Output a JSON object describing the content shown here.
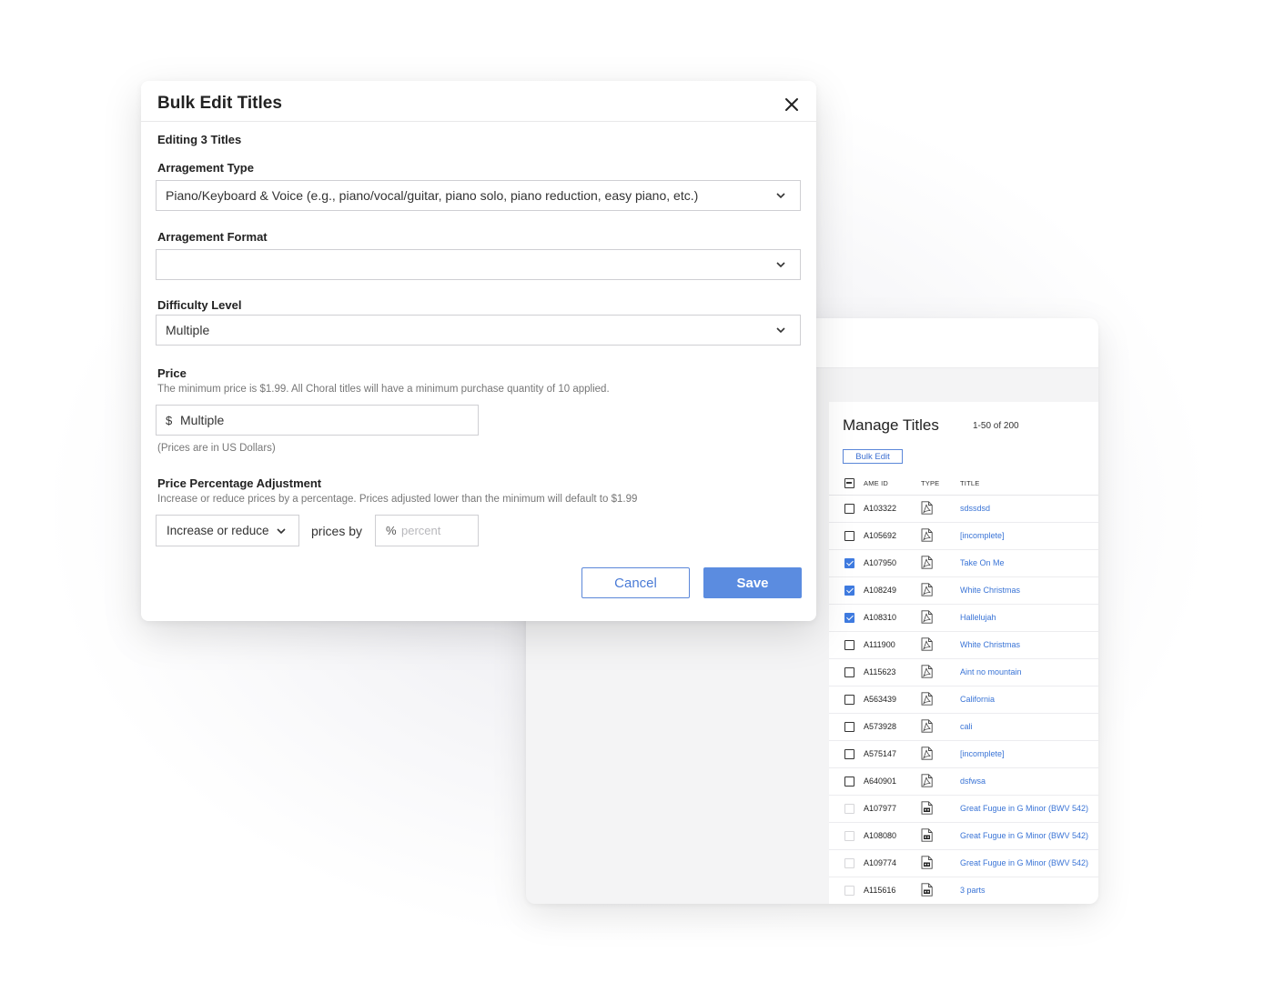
{
  "modal": {
    "title": "Bulk Edit Titles",
    "editing_label": "Editing 3 Titles",
    "arrangement_type": {
      "label": "Arragement Type",
      "value": "Piano/Keyboard & Voice (e.g., piano/vocal/guitar, piano solo, piano reduction, easy piano, etc.)"
    },
    "arrangement_format": {
      "label": "Arragement Format",
      "value": ""
    },
    "difficulty": {
      "label": "Difficulty Level",
      "value": "Multiple"
    },
    "price": {
      "label": "Price",
      "help": "The minimum price is $1.99. All Choral titles will have a minimum purchase quantity of 10 applied.",
      "currency": "$",
      "value": "Multiple",
      "note": "(Prices are in US Dollars)"
    },
    "adjustment": {
      "label": "Price Percentage Adjustment",
      "help": "Increase or reduce prices by a percentage. Prices adjusted lower than the minimum will default to $1.99",
      "direction": "Increase or reduce",
      "prices_by": "prices by",
      "percent_sign": "%",
      "percent_placeholder": "percent"
    },
    "cancel_label": "Cancel",
    "save_label": "Save"
  },
  "manage": {
    "title": "Manage Titles",
    "count": "1-50 of 200",
    "bulk_edit_label": "Bulk Edit",
    "columns": {
      "id": "AME ID",
      "type": "TYPE",
      "title": "TITLE"
    },
    "rows": [
      {
        "id": "A103322",
        "title": "sdssdsd",
        "checked": false,
        "disabled": false,
        "type": "pdf"
      },
      {
        "id": "A105692",
        "title": "[incomplete]",
        "checked": false,
        "disabled": false,
        "type": "pdf"
      },
      {
        "id": "A107950",
        "title": "Take On Me",
        "checked": true,
        "disabled": false,
        "type": "pdf"
      },
      {
        "id": "A108249",
        "title": "White Christmas",
        "checked": true,
        "disabled": false,
        "type": "pdf"
      },
      {
        "id": "A108310",
        "title": "Hallelujah",
        "checked": true,
        "disabled": false,
        "type": "pdf"
      },
      {
        "id": "A111900",
        "title": "White Christmas",
        "checked": false,
        "disabled": false,
        "type": "pdf"
      },
      {
        "id": "A115623",
        "title": "Aint no mountain",
        "checked": false,
        "disabled": false,
        "type": "pdf"
      },
      {
        "id": "A563439",
        "title": "California",
        "checked": false,
        "disabled": false,
        "type": "pdf"
      },
      {
        "id": "A573928",
        "title": "cali",
        "checked": false,
        "disabled": false,
        "type": "pdf"
      },
      {
        "id": "A575147",
        "title": "[incomplete]",
        "checked": false,
        "disabled": false,
        "type": "pdf"
      },
      {
        "id": "A640901",
        "title": "dsfwsa",
        "checked": false,
        "disabled": false,
        "type": "pdf"
      },
      {
        "id": "A107977",
        "title": "Great Fugue in G Minor (BWV 542)",
        "checked": false,
        "disabled": true,
        "type": "audio"
      },
      {
        "id": "A108080",
        "title": "Great Fugue in G Minor (BWV 542)",
        "checked": false,
        "disabled": true,
        "type": "audio"
      },
      {
        "id": "A109774",
        "title": "Great Fugue in G Minor (BWV 542)",
        "checked": false,
        "disabled": true,
        "type": "audio"
      },
      {
        "id": "A115616",
        "title": "3 parts",
        "checked": false,
        "disabled": true,
        "type": "audio"
      }
    ]
  }
}
